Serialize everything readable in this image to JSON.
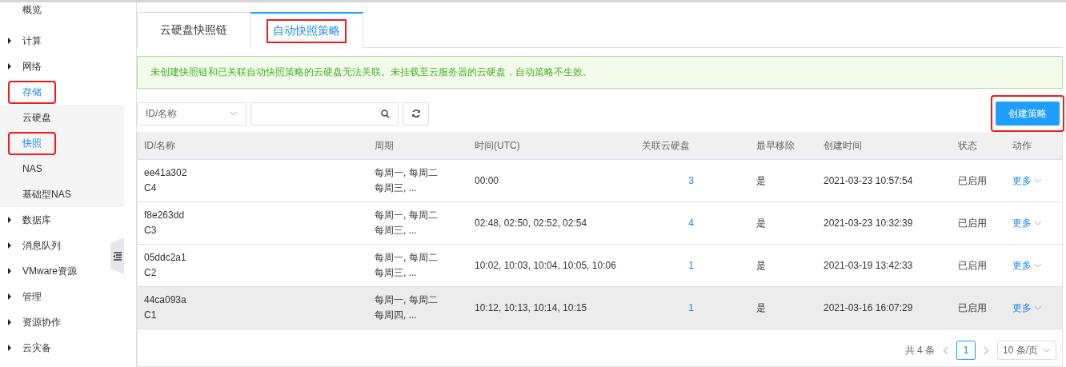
{
  "sidebar": {
    "items": [
      {
        "label": "概览",
        "has_caret": false,
        "selected": false,
        "highlighted": false
      },
      {
        "label": "计算",
        "has_caret": true,
        "selected": false,
        "highlighted": false
      },
      {
        "label": "网络",
        "has_caret": true,
        "selected": false,
        "highlighted": false
      },
      {
        "label": "存储",
        "has_caret": false,
        "selected": true,
        "highlighted": true,
        "children": [
          {
            "label": "云硬盘",
            "selected": false,
            "highlighted": false
          },
          {
            "label": "快照",
            "selected": true,
            "highlighted": true
          },
          {
            "label": "NAS",
            "selected": false,
            "highlighted": false
          },
          {
            "label": "基础型NAS",
            "selected": false,
            "highlighted": false
          }
        ]
      },
      {
        "label": "数据库",
        "has_caret": true,
        "selected": false,
        "highlighted": false
      },
      {
        "label": "消息队列",
        "has_caret": true,
        "selected": false,
        "highlighted": false
      },
      {
        "label": "VMware资源",
        "has_caret": true,
        "selected": false,
        "highlighted": false
      },
      {
        "label": "管理",
        "has_caret": true,
        "selected": false,
        "highlighted": false
      },
      {
        "label": "资源协作",
        "has_caret": true,
        "selected": false,
        "highlighted": false
      },
      {
        "label": "云灾备",
        "has_caret": true,
        "selected": false,
        "highlighted": false
      }
    ]
  },
  "tabs": [
    {
      "label": "云硬盘快照链",
      "selected": false,
      "highlighted": false
    },
    {
      "label": "自动快照策略",
      "selected": true,
      "highlighted": true
    }
  ],
  "notice": "未创建快照链和已关联自动快照策略的云硬盘无法关联。未挂载至云服务器的云硬盘，自动策略不生效。",
  "toolbar": {
    "filter_select": "ID/名称",
    "create_button": {
      "label": "创建策略",
      "highlighted": true
    }
  },
  "table": {
    "columns": [
      "ID/名称",
      "周期",
      "时间(UTC)",
      "关联云硬盘",
      "最早移除",
      "创建时间",
      "状态",
      "动作"
    ],
    "rows": [
      {
        "id": "ee41a302",
        "name": "C4",
        "cycle": [
          "每周一, 每周二",
          "每周三, ..."
        ],
        "time": "00:00",
        "disks": "3",
        "earliest_remove": "是",
        "created": "2021-03-23 10:57:54",
        "status": "已启用",
        "action": "更多",
        "hovered": false
      },
      {
        "id": "f8e263dd",
        "name": "C3",
        "cycle": [
          "每周一, 每周二",
          "每周三, ..."
        ],
        "time": "02:48, 02:50, 02:52, 02:54",
        "disks": "4",
        "earliest_remove": "是",
        "created": "2021-03-23 10:32:39",
        "status": "已启用",
        "action": "更多",
        "hovered": false
      },
      {
        "id": "05ddc2a1",
        "name": "C2",
        "cycle": [
          "每周一, 每周二",
          "每周三, ..."
        ],
        "time": "10:02, 10:03, 10:04, 10:05, 10:06",
        "disks": "1",
        "earliest_remove": "是",
        "created": "2021-03-19 13:42:33",
        "status": "已启用",
        "action": "更多",
        "hovered": false
      },
      {
        "id": "44ca093a",
        "name": "C1",
        "cycle": [
          "每周一, 每周二",
          "每周四, ..."
        ],
        "time": "10:12, 10:13, 10:14, 10:15",
        "disks": "1",
        "earliest_remove": "是",
        "created": "2021-03-16 16:07:29",
        "status": "已启用",
        "action": "更多",
        "hovered": true
      }
    ]
  },
  "pagination": {
    "total": "共 4 条",
    "pages": [
      {
        "label": "1",
        "selected": true
      }
    ],
    "page_size": "10 条/页"
  }
}
